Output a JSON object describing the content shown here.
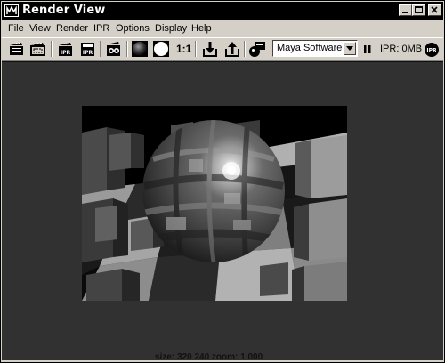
{
  "window": {
    "title": "Render View",
    "title_icon": "maya-render-view-icon",
    "controls": [
      "minimize-icon",
      "maximize-icon",
      "close-icon"
    ]
  },
  "menu": {
    "items": [
      "File",
      "View",
      "Render",
      "IPR",
      "Options",
      "Display",
      "Help"
    ]
  },
  "toolbar": {
    "zoom_ratio": "1:1",
    "renderer": "Maya Software",
    "ipr_memory": "IPR: 0MB",
    "icons": [
      "redo-previous-render-icon",
      "render-region-icon",
      "redo-ipr-render-icon",
      "ipr-render-icon",
      "snapshot-render-icon",
      "display-rgb-channels-icon",
      "display-alpha-channel-icon",
      "real-size-icon",
      "keep-image-icon",
      "remove-image-icon",
      "render-globals-icon",
      "pause-ipr-icon",
      "ipr-status-icon"
    ]
  },
  "render": {
    "status": "size: 320 240 zoom: 1.000"
  },
  "colors": {
    "title_bar": "#000000",
    "chrome": "#d4d0c8",
    "viewport_bg": "#313131"
  }
}
